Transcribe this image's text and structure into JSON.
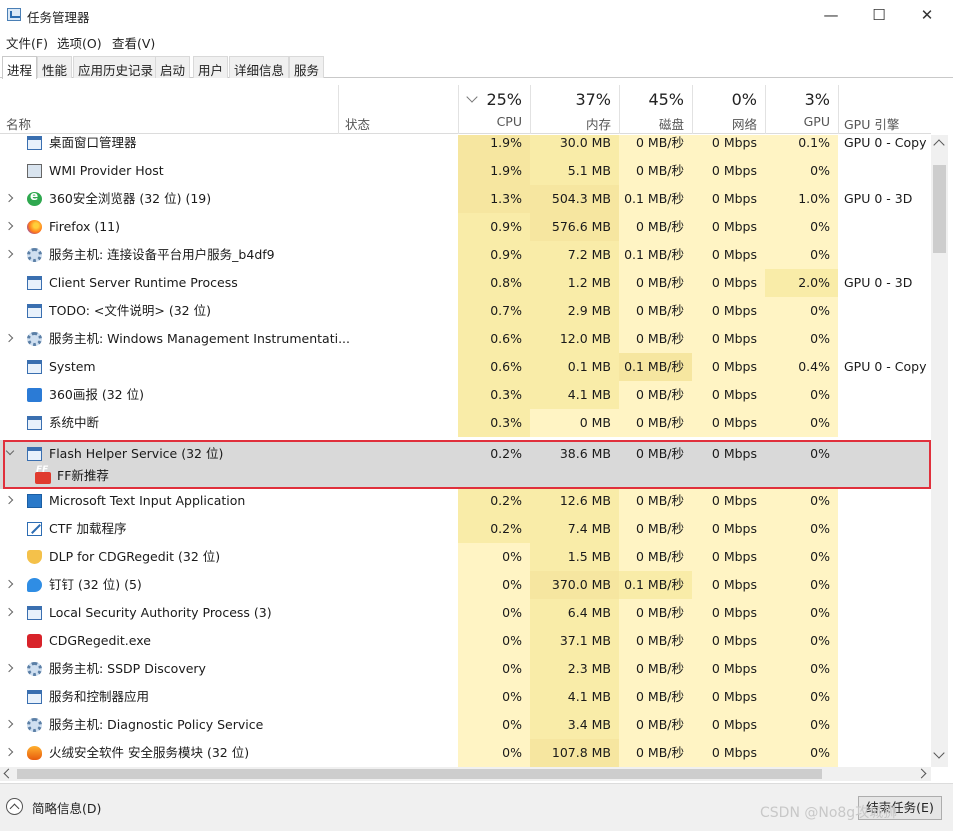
{
  "window": {
    "title": "任务管理器",
    "controls": {
      "minimize": "—",
      "maximize": "☐",
      "close": "✕"
    }
  },
  "menu": [
    "文件(F)",
    "选项(O)",
    "查看(V)"
  ],
  "tabs": [
    "进程",
    "性能",
    "应用历史记录",
    "启动",
    "用户",
    "详细信息",
    "服务"
  ],
  "active_tab": "进程",
  "columns": {
    "name": "名称",
    "status": "状态",
    "cpu": {
      "pct": "25%",
      "label": "CPU"
    },
    "memory": {
      "pct": "37%",
      "label": "内存"
    },
    "disk": {
      "pct": "45%",
      "label": "磁盘"
    },
    "network": {
      "pct": "0%",
      "label": "网络"
    },
    "gpu": {
      "pct": "3%",
      "label": "GPU"
    },
    "gpu_engine": "GPU 引擎"
  },
  "processes": [
    {
      "name": "桌面窗口管理器",
      "icon": "window-icon",
      "expandable": false,
      "cpu": "1.9%",
      "mem": "30.0 MB",
      "disk": "0 MB/秒",
      "net": "0 Mbps",
      "gpu": "0.1%",
      "engine": "GPU 0 - Copy",
      "heat": [
        3,
        2,
        1,
        1,
        1
      ]
    },
    {
      "name": "WMI Provider Host",
      "icon": "wmi-icon",
      "expandable": false,
      "cpu": "1.9%",
      "mem": "5.1 MB",
      "disk": "0 MB/秒",
      "net": "0 Mbps",
      "gpu": "0%",
      "engine": "",
      "heat": [
        3,
        2,
        1,
        1,
        1
      ]
    },
    {
      "name": "360安全浏览器 (32 位) (19)",
      "icon": "browser-360-icon",
      "expandable": true,
      "cpu": "1.3%",
      "mem": "504.3 MB",
      "disk": "0.1 MB/秒",
      "net": "0 Mbps",
      "gpu": "1.0%",
      "engine": "GPU 0 - 3D",
      "heat": [
        3,
        3,
        1,
        1,
        1
      ]
    },
    {
      "name": "Firefox (11)",
      "icon": "firefox-icon",
      "expandable": true,
      "cpu": "0.9%",
      "mem": "576.6 MB",
      "disk": "0 MB/秒",
      "net": "0 Mbps",
      "gpu": "0%",
      "engine": "",
      "heat": [
        2,
        3,
        1,
        1,
        1
      ]
    },
    {
      "name": "服务主机: 连接设备平台用户服务_b4df9",
      "icon": "gear-icon",
      "expandable": true,
      "cpu": "0.9%",
      "mem": "7.2 MB",
      "disk": "0.1 MB/秒",
      "net": "0 Mbps",
      "gpu": "0%",
      "engine": "",
      "heat": [
        2,
        2,
        1,
        1,
        1
      ]
    },
    {
      "name": "Client Server Runtime Process",
      "icon": "window-icon",
      "expandable": false,
      "cpu": "0.8%",
      "mem": "1.2 MB",
      "disk": "0 MB/秒",
      "net": "0 Mbps",
      "gpu": "2.0%",
      "engine": "GPU 0 - 3D",
      "heat": [
        2,
        2,
        1,
        1,
        2
      ]
    },
    {
      "name": "TODO: <文件说明> (32 位)",
      "icon": "window-icon",
      "expandable": false,
      "cpu": "0.7%",
      "mem": "2.9 MB",
      "disk": "0 MB/秒",
      "net": "0 Mbps",
      "gpu": "0%",
      "engine": "",
      "heat": [
        2,
        2,
        1,
        1,
        1
      ]
    },
    {
      "name": "服务主机: Windows Management Instrumentati...",
      "icon": "gear-icon",
      "expandable": true,
      "cpu": "0.6%",
      "mem": "12.0 MB",
      "disk": "0 MB/秒",
      "net": "0 Mbps",
      "gpu": "0%",
      "engine": "",
      "heat": [
        2,
        2,
        1,
        1,
        1
      ]
    },
    {
      "name": "System",
      "icon": "window-icon",
      "expandable": false,
      "cpu": "0.6%",
      "mem": "0.1 MB",
      "disk": "0.1 MB/秒",
      "net": "0 Mbps",
      "gpu": "0.4%",
      "engine": "GPU 0 - Copy",
      "heat": [
        2,
        2,
        3,
        1,
        1
      ]
    },
    {
      "name": "360画报 (32 位)",
      "icon": "blue-app-icon",
      "expandable": false,
      "cpu": "0.3%",
      "mem": "4.1 MB",
      "disk": "0 MB/秒",
      "net": "0 Mbps",
      "gpu": "0%",
      "engine": "",
      "heat": [
        2,
        2,
        1,
        1,
        1
      ]
    },
    {
      "name": "系统中断",
      "icon": "window-icon",
      "expandable": false,
      "cpu": "0.3%",
      "mem": "0 MB",
      "disk": "0 MB/秒",
      "net": "0 Mbps",
      "gpu": "0%",
      "engine": "",
      "heat": [
        2,
        1,
        1,
        1,
        1
      ]
    }
  ],
  "selected_group": {
    "name": "Flash Helper Service (32 位)",
    "cpu": "0.2%",
    "mem": "38.6 MB",
    "disk": "0 MB/秒",
    "net": "0 Mbps",
    "gpu": "0%",
    "child": "FF新推荐"
  },
  "processes_after": [
    {
      "name": "Microsoft Text Input Application",
      "icon": "keyboard-icon",
      "expandable": true,
      "cpu": "0.2%",
      "mem": "12.6 MB",
      "disk": "0 MB/秒",
      "net": "0 Mbps",
      "gpu": "0%",
      "engine": "",
      "heat": [
        2,
        2,
        1,
        1,
        1
      ]
    },
    {
      "name": "CTF 加载程序",
      "icon": "pen-icon",
      "expandable": false,
      "cpu": "0.2%",
      "mem": "7.4 MB",
      "disk": "0 MB/秒",
      "net": "0 Mbps",
      "gpu": "0%",
      "engine": "",
      "heat": [
        2,
        2,
        1,
        1,
        1
      ]
    },
    {
      "name": "DLP for CDGRegedit (32 位)",
      "icon": "shield-icon",
      "expandable": false,
      "cpu": "0%",
      "mem": "1.5 MB",
      "disk": "0 MB/秒",
      "net": "0 Mbps",
      "gpu": "0%",
      "engine": "",
      "heat": [
        1,
        2,
        1,
        1,
        1
      ]
    },
    {
      "name": "钉钉 (32 位) (5)",
      "icon": "dingtalk-icon",
      "expandable": true,
      "cpu": "0%",
      "mem": "370.0 MB",
      "disk": "0.1 MB/秒",
      "net": "0 Mbps",
      "gpu": "0%",
      "engine": "",
      "heat": [
        1,
        3,
        2,
        1,
        1
      ]
    },
    {
      "name": "Local Security Authority Process (3)",
      "icon": "window-icon",
      "expandable": true,
      "cpu": "0%",
      "mem": "6.4 MB",
      "disk": "0 MB/秒",
      "net": "0 Mbps",
      "gpu": "0%",
      "engine": "",
      "heat": [
        1,
        2,
        1,
        1,
        1
      ]
    },
    {
      "name": "CDGRegedit.exe",
      "icon": "red-app-icon",
      "expandable": false,
      "cpu": "0%",
      "mem": "37.1 MB",
      "disk": "0 MB/秒",
      "net": "0 Mbps",
      "gpu": "0%",
      "engine": "",
      "heat": [
        1,
        2,
        1,
        1,
        1
      ]
    },
    {
      "name": "服务主机: SSDP Discovery",
      "icon": "gear-icon",
      "expandable": true,
      "cpu": "0%",
      "mem": "2.3 MB",
      "disk": "0 MB/秒",
      "net": "0 Mbps",
      "gpu": "0%",
      "engine": "",
      "heat": [
        1,
        2,
        1,
        1,
        1
      ]
    },
    {
      "name": "服务和控制器应用",
      "icon": "window-icon",
      "expandable": false,
      "cpu": "0%",
      "mem": "4.1 MB",
      "disk": "0 MB/秒",
      "net": "0 Mbps",
      "gpu": "0%",
      "engine": "",
      "heat": [
        1,
        2,
        1,
        1,
        1
      ]
    },
    {
      "name": "服务主机: Diagnostic Policy Service",
      "icon": "gear-icon",
      "expandable": true,
      "cpu": "0%",
      "mem": "3.4 MB",
      "disk": "0 MB/秒",
      "net": "0 Mbps",
      "gpu": "0%",
      "engine": "",
      "heat": [
        1,
        2,
        1,
        1,
        1
      ]
    },
    {
      "name": "火绒安全软件 安全服务模块 (32 位)",
      "icon": "fire-icon",
      "expandable": true,
      "cpu": "0%",
      "mem": "107.8 MB",
      "disk": "0 MB/秒",
      "net": "0 Mbps",
      "gpu": "0%",
      "engine": "",
      "heat": [
        1,
        3,
        1,
        1,
        1
      ]
    }
  ],
  "footer": {
    "fewer_details": "简略信息(D)",
    "end_task": "结束任务(E)",
    "watermark": "CSDN @No8g攻城狮"
  }
}
